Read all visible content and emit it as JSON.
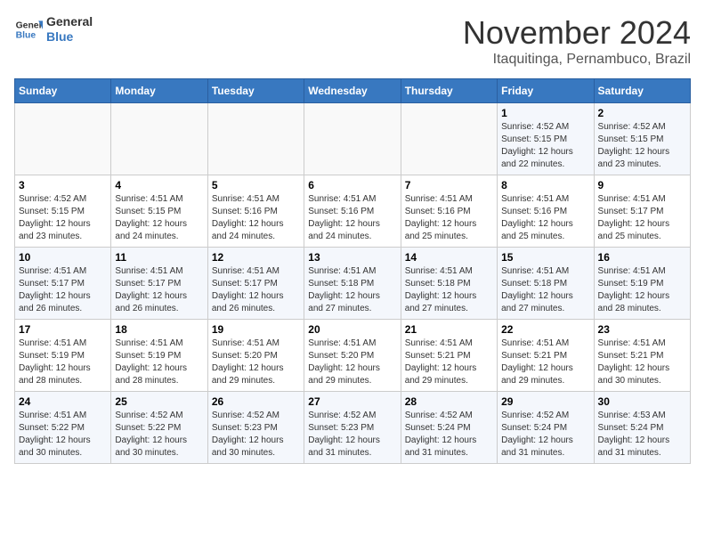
{
  "header": {
    "logo_line1": "General",
    "logo_line2": "Blue",
    "month": "November 2024",
    "location": "Itaquitinga, Pernambuco, Brazil"
  },
  "weekdays": [
    "Sunday",
    "Monday",
    "Tuesday",
    "Wednesday",
    "Thursday",
    "Friday",
    "Saturday"
  ],
  "weeks": [
    [
      {
        "day": "",
        "info": ""
      },
      {
        "day": "",
        "info": ""
      },
      {
        "day": "",
        "info": ""
      },
      {
        "day": "",
        "info": ""
      },
      {
        "day": "",
        "info": ""
      },
      {
        "day": "1",
        "info": "Sunrise: 4:52 AM\nSunset: 5:15 PM\nDaylight: 12 hours\nand 22 minutes."
      },
      {
        "day": "2",
        "info": "Sunrise: 4:52 AM\nSunset: 5:15 PM\nDaylight: 12 hours\nand 23 minutes."
      }
    ],
    [
      {
        "day": "3",
        "info": "Sunrise: 4:52 AM\nSunset: 5:15 PM\nDaylight: 12 hours\nand 23 minutes."
      },
      {
        "day": "4",
        "info": "Sunrise: 4:51 AM\nSunset: 5:15 PM\nDaylight: 12 hours\nand 24 minutes."
      },
      {
        "day": "5",
        "info": "Sunrise: 4:51 AM\nSunset: 5:16 PM\nDaylight: 12 hours\nand 24 minutes."
      },
      {
        "day": "6",
        "info": "Sunrise: 4:51 AM\nSunset: 5:16 PM\nDaylight: 12 hours\nand 24 minutes."
      },
      {
        "day": "7",
        "info": "Sunrise: 4:51 AM\nSunset: 5:16 PM\nDaylight: 12 hours\nand 25 minutes."
      },
      {
        "day": "8",
        "info": "Sunrise: 4:51 AM\nSunset: 5:16 PM\nDaylight: 12 hours\nand 25 minutes."
      },
      {
        "day": "9",
        "info": "Sunrise: 4:51 AM\nSunset: 5:17 PM\nDaylight: 12 hours\nand 25 minutes."
      }
    ],
    [
      {
        "day": "10",
        "info": "Sunrise: 4:51 AM\nSunset: 5:17 PM\nDaylight: 12 hours\nand 26 minutes."
      },
      {
        "day": "11",
        "info": "Sunrise: 4:51 AM\nSunset: 5:17 PM\nDaylight: 12 hours\nand 26 minutes."
      },
      {
        "day": "12",
        "info": "Sunrise: 4:51 AM\nSunset: 5:17 PM\nDaylight: 12 hours\nand 26 minutes."
      },
      {
        "day": "13",
        "info": "Sunrise: 4:51 AM\nSunset: 5:18 PM\nDaylight: 12 hours\nand 27 minutes."
      },
      {
        "day": "14",
        "info": "Sunrise: 4:51 AM\nSunset: 5:18 PM\nDaylight: 12 hours\nand 27 minutes."
      },
      {
        "day": "15",
        "info": "Sunrise: 4:51 AM\nSunset: 5:18 PM\nDaylight: 12 hours\nand 27 minutes."
      },
      {
        "day": "16",
        "info": "Sunrise: 4:51 AM\nSunset: 5:19 PM\nDaylight: 12 hours\nand 28 minutes."
      }
    ],
    [
      {
        "day": "17",
        "info": "Sunrise: 4:51 AM\nSunset: 5:19 PM\nDaylight: 12 hours\nand 28 minutes."
      },
      {
        "day": "18",
        "info": "Sunrise: 4:51 AM\nSunset: 5:19 PM\nDaylight: 12 hours\nand 28 minutes."
      },
      {
        "day": "19",
        "info": "Sunrise: 4:51 AM\nSunset: 5:20 PM\nDaylight: 12 hours\nand 29 minutes."
      },
      {
        "day": "20",
        "info": "Sunrise: 4:51 AM\nSunset: 5:20 PM\nDaylight: 12 hours\nand 29 minutes."
      },
      {
        "day": "21",
        "info": "Sunrise: 4:51 AM\nSunset: 5:21 PM\nDaylight: 12 hours\nand 29 minutes."
      },
      {
        "day": "22",
        "info": "Sunrise: 4:51 AM\nSunset: 5:21 PM\nDaylight: 12 hours\nand 29 minutes."
      },
      {
        "day": "23",
        "info": "Sunrise: 4:51 AM\nSunset: 5:21 PM\nDaylight: 12 hours\nand 30 minutes."
      }
    ],
    [
      {
        "day": "24",
        "info": "Sunrise: 4:51 AM\nSunset: 5:22 PM\nDaylight: 12 hours\nand 30 minutes."
      },
      {
        "day": "25",
        "info": "Sunrise: 4:52 AM\nSunset: 5:22 PM\nDaylight: 12 hours\nand 30 minutes."
      },
      {
        "day": "26",
        "info": "Sunrise: 4:52 AM\nSunset: 5:23 PM\nDaylight: 12 hours\nand 30 minutes."
      },
      {
        "day": "27",
        "info": "Sunrise: 4:52 AM\nSunset: 5:23 PM\nDaylight: 12 hours\nand 31 minutes."
      },
      {
        "day": "28",
        "info": "Sunrise: 4:52 AM\nSunset: 5:24 PM\nDaylight: 12 hours\nand 31 minutes."
      },
      {
        "day": "29",
        "info": "Sunrise: 4:52 AM\nSunset: 5:24 PM\nDaylight: 12 hours\nand 31 minutes."
      },
      {
        "day": "30",
        "info": "Sunrise: 4:53 AM\nSunset: 5:24 PM\nDaylight: 12 hours\nand 31 minutes."
      }
    ]
  ]
}
